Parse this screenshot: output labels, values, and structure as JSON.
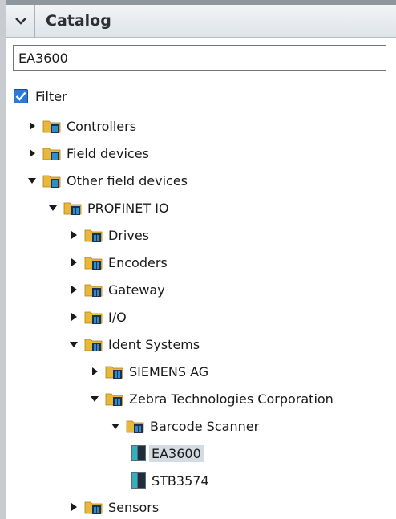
{
  "catalog": {
    "title": "Catalog",
    "search_value": "EA3600",
    "filter_label": "Filter",
    "filter_checked": true
  },
  "tree": [
    {
      "label": "Controllers",
      "state": "collapsed",
      "icon": "folder-icon"
    },
    {
      "label": "Field devices",
      "state": "collapsed",
      "icon": "folder-icon"
    },
    {
      "label": "Other field devices",
      "state": "expanded",
      "icon": "folder-icon"
    },
    {
      "label": "PROFINET IO",
      "state": "expanded",
      "icon": "folder-icon"
    },
    {
      "label": "Drives",
      "state": "collapsed",
      "icon": "folder-icon"
    },
    {
      "label": "Encoders",
      "state": "collapsed",
      "icon": "folder-icon"
    },
    {
      "label": "Gateway",
      "state": "collapsed",
      "icon": "folder-icon"
    },
    {
      "label": "I/O",
      "state": "collapsed",
      "icon": "folder-icon"
    },
    {
      "label": "Ident Systems",
      "state": "expanded",
      "icon": "folder-icon"
    },
    {
      "label": "SIEMENS AG",
      "state": "collapsed",
      "icon": "folder-icon"
    },
    {
      "label": "Zebra Technologies Corporation",
      "state": "expanded",
      "icon": "folder-icon"
    },
    {
      "label": "Barcode Scanner",
      "state": "expanded",
      "icon": "folder-icon"
    },
    {
      "label": "EA3600",
      "state": "leaf",
      "icon": "device-icon",
      "selected": true
    },
    {
      "label": "STB3574",
      "state": "leaf",
      "icon": "device-icon"
    },
    {
      "label": "Sensors",
      "state": "collapsed",
      "icon": "folder-icon"
    }
  ],
  "colors": {
    "folder": "#e8b83a",
    "folder_badge": "#2d8fc9",
    "selection": "#d3dbe3",
    "checkbox": "#2b79d8"
  }
}
